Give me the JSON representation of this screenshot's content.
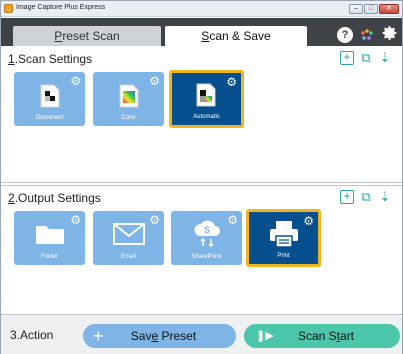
{
  "window": {
    "title": "Image Capture Plus Express",
    "min": "–",
    "max": "□",
    "close": "✕"
  },
  "tabs": [
    {
      "label_pre": "",
      "label_ul": "P",
      "label_post": "reset Scan"
    },
    {
      "label_pre": "",
      "label_ul": "S",
      "label_post": "can & Save"
    }
  ],
  "toolbar": {
    "help": "?"
  },
  "scan_settings": {
    "title_ul": "1",
    "title_post": ".Scan Settings",
    "cards": [
      {
        "label": "Document",
        "selected": false
      },
      {
        "label": "Color",
        "selected": false
      },
      {
        "label": "Automatic",
        "selected": true
      }
    ]
  },
  "output_settings": {
    "title_ul": "2",
    "title_post": ".Output Settings",
    "cards": [
      {
        "label": "Folder",
        "selected": false
      },
      {
        "label": "Email",
        "selected": false
      },
      {
        "label": "SharePoint",
        "selected": false
      },
      {
        "label": "Print",
        "selected": true
      }
    ]
  },
  "action": {
    "label": "3.Action",
    "save_pre": "Sav",
    "save_ul": "e",
    "save_post": " Preset",
    "start_pre": "Scan S",
    "start_ul": "t",
    "start_post": "art"
  },
  "icons": {
    "add": "+",
    "copy": "⧉",
    "sort": "⇣"
  },
  "colors": {
    "card_blue": "#7fb5e6",
    "card_selected": "#064f8e",
    "selected_border": "#f1b51c",
    "teal": "#4cc6aa"
  }
}
